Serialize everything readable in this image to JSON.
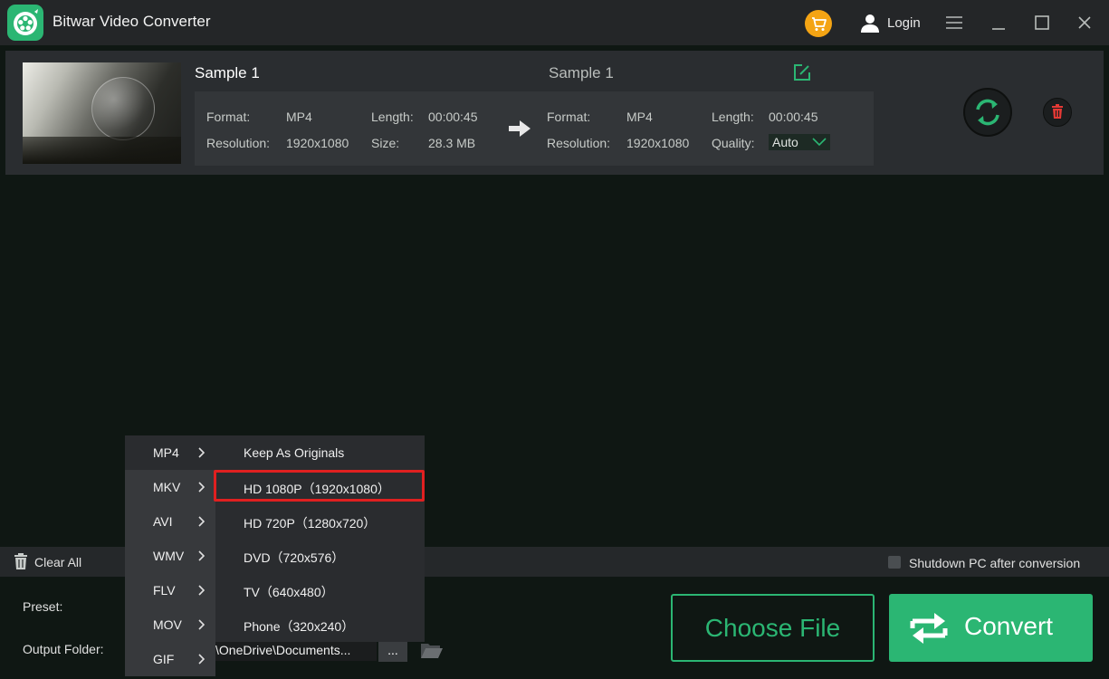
{
  "app": {
    "title": "Bitwar Video Converter",
    "login": "Login"
  },
  "colors": {
    "accent": "#2bb673",
    "cart": "#f4a414",
    "delete": "#e53935",
    "highlight": "#e02020"
  },
  "file": {
    "source_name": "Sample 1",
    "target_name": "Sample 1",
    "labels": {
      "format": "Format:",
      "resolution": "Resolution:",
      "length": "Length:",
      "size": "Size:",
      "quality": "Quality:"
    },
    "source": {
      "format": "MP4",
      "resolution": "1920x1080",
      "length": "00:00:45",
      "size": "28.3 MB"
    },
    "target": {
      "format": "MP4",
      "resolution": "1920x1080",
      "length": "00:00:45",
      "quality": "Auto"
    }
  },
  "status": {
    "clear_all": "Clear All",
    "shutdown": "Shutdown PC after conversion"
  },
  "bottom": {
    "preset_label": "Preset:",
    "output_label": "Output Folder:",
    "output_path": "\\OneDrive\\Documents...",
    "browse": "...",
    "choose_file": "Choose File",
    "convert": "Convert"
  },
  "menu": {
    "formats": [
      "MP4",
      "MKV",
      "AVI",
      "WMV",
      "FLV",
      "MOV",
      "GIF"
    ],
    "active_format": "MP4",
    "resolutions": [
      "Keep As Originals",
      "HD 1080P（1920x1080）",
      "HD 720P（1280x720）",
      "DVD（720x576）",
      "TV（640x480）",
      "Phone（320x240）"
    ],
    "highlighted_resolution": "HD 1080P（1920x1080）"
  },
  "icons": {
    "logo": "app-logo-icon",
    "cart": "cart-icon",
    "user": "user-icon",
    "menu": "hamburger-menu-icon",
    "minimize": "minimize-icon",
    "maximize": "maximize-icon",
    "close": "close-icon",
    "edit": "edit-icon",
    "arrow": "arrow-right-icon",
    "convert": "convert-arrows-icon",
    "delete": "trash-icon",
    "folder": "folder-icon",
    "chevron": "chevron-right-icon"
  }
}
